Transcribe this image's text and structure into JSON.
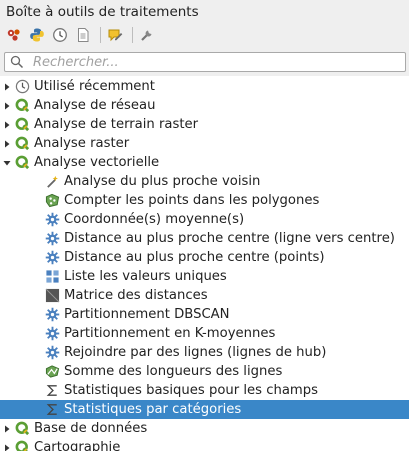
{
  "panel": {
    "title": "Boîte à outils de traitements"
  },
  "toolbar": {
    "buttons": [
      {
        "icon": "models-icon"
      },
      {
        "icon": "python-icon"
      },
      {
        "icon": "history-icon"
      },
      {
        "icon": "results-icon"
      },
      {
        "icon": "edit-in-place-icon"
      },
      {
        "icon": "options-icon"
      }
    ]
  },
  "search": {
    "placeholder": "Rechercher..."
  },
  "tree": {
    "groups": [
      {
        "label": "Utilisé récemment",
        "icon": "clock-icon",
        "expanded": false
      },
      {
        "label": "Analyse de réseau",
        "icon": "qgis-icon",
        "expanded": false
      },
      {
        "label": "Analyse de terrain raster",
        "icon": "qgis-icon",
        "expanded": false
      },
      {
        "label": "Analyse raster",
        "icon": "qgis-icon",
        "expanded": false
      },
      {
        "label": "Analyse vectorielle",
        "icon": "qgis-icon",
        "expanded": true
      }
    ],
    "tools": [
      {
        "label": "Analyse du plus proche voisin",
        "icon": "wand-icon"
      },
      {
        "label": "Compter les points dans les polygones",
        "icon": "points-polygon-icon"
      },
      {
        "label": "Coordonnée(s) moyenne(s)",
        "icon": "gear-blue-icon"
      },
      {
        "label": "Distance au plus proche centre (ligne vers centre)",
        "icon": "gear-blue-icon"
      },
      {
        "label": "Distance au plus proche centre (points)",
        "icon": "gear-blue-icon"
      },
      {
        "label": "Liste les valeurs uniques",
        "icon": "unique-values-icon"
      },
      {
        "label": "Matrice des distances",
        "icon": "matrix-icon"
      },
      {
        "label": "Partitionnement DBSCAN",
        "icon": "gear-blue-icon"
      },
      {
        "label": "Partitionnement en K-moyennes",
        "icon": "gear-blue-icon"
      },
      {
        "label": "Rejoindre par des lignes (lignes de hub)",
        "icon": "gear-blue-icon"
      },
      {
        "label": "Somme des longueurs des lignes",
        "icon": "sum-lines-icon"
      },
      {
        "label": "Statistiques basiques pour les champs",
        "icon": "sigma-icon"
      },
      {
        "label": "Statistiques par catégories",
        "icon": "sigma-icon",
        "selected": true
      }
    ],
    "after": [
      {
        "label": "Base de données",
        "icon": "qgis-icon",
        "expanded": false
      },
      {
        "label": "Cartographie",
        "icon": "qgis-icon",
        "expanded": false
      }
    ]
  },
  "colors": {
    "selection": "#3a87c8",
    "qgis_green": "#5a9e34",
    "tool_blue": "#4a80bf"
  }
}
